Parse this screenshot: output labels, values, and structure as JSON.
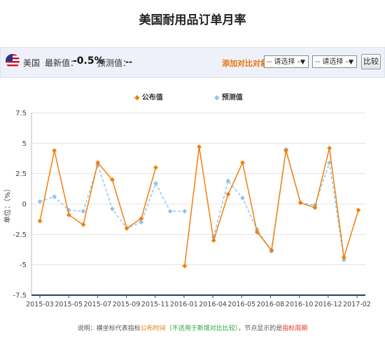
{
  "page": {
    "title": "美国耐用品订单月率",
    "country": "美国",
    "latest_label": "最新值：",
    "latest_value": "-0.5%",
    "forecast_label": "预测值：",
    "forecast_value": "--",
    "compare_label": "添加对比对象：",
    "select1": "-- 请选择 --",
    "select2": "-- 请选择 --",
    "compare_button": "比较",
    "footnote": {
      "part1": "说明：横坐标代表指标",
      "part2": "公布时间",
      "part3": "（不适用于新增对比比较）",
      "part4": "，节点显示的是",
      "part5": "指标周期"
    }
  },
  "chart_data": {
    "type": "line",
    "ylabel": "单位：（%）",
    "ylim": [
      -7.5,
      7.5
    ],
    "yticks": [
      -7.5,
      -5,
      -2.5,
      0,
      2.5,
      5,
      7.5
    ],
    "ytick_labels": [
      "-7.5",
      "-5",
      "-2.5",
      "0",
      "2.5",
      "5",
      "7.5"
    ],
    "xtick_labels": [
      "2015-03",
      "2015-05",
      "2015-07",
      "2015-09",
      "2015-11",
      "2016-01",
      "2016-04",
      "2016-05",
      "2016-08",
      "2016-10",
      "2016-12",
      "2017-02"
    ],
    "grid": "horizontal",
    "legend_position": "top-center",
    "n_points": 23,
    "series": [
      {
        "name": "公布值",
        "color": "#f27f0c",
        "dashed": false,
        "marker": "diamond",
        "values": [
          -1.4,
          4.4,
          -0.9,
          -1.7,
          3.4,
          2.0,
          -2.0,
          -1.2,
          3.0,
          null,
          -5.1,
          4.7,
          -3.0,
          0.8,
          3.4,
          -2.3,
          -3.8,
          4.4,
          0.1,
          -0.3,
          4.6,
          -4.4,
          -0.5
        ]
      },
      {
        "name": "预测值",
        "color": "#8fc5ef",
        "dashed": true,
        "marker": "diamond",
        "values": [
          0.2,
          0.6,
          -0.5,
          -0.6,
          3.2,
          -0.4,
          -2.0,
          -1.5,
          1.7,
          -0.6,
          -0.6,
          null,
          -2.7,
          1.9,
          0.5,
          -2.1,
          -3.9,
          4.5,
          0.1,
          -0.1,
          3.4,
          -4.6,
          null
        ]
      }
    ]
  }
}
